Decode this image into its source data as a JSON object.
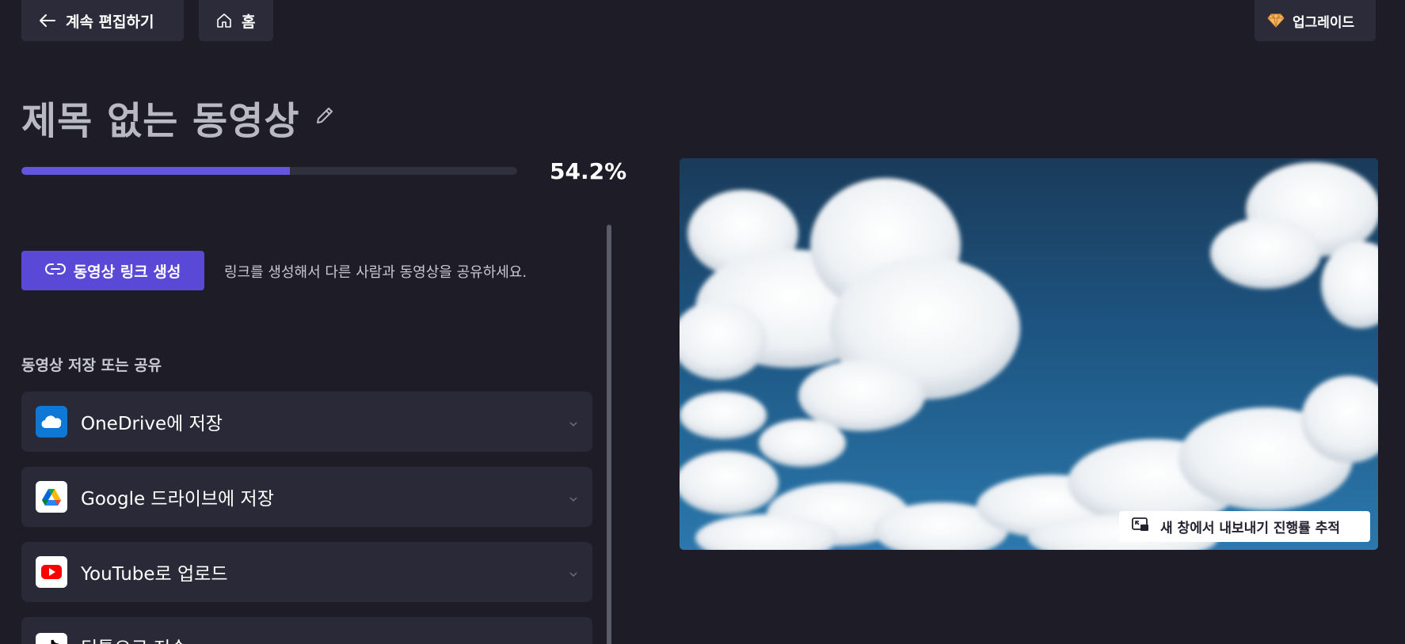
{
  "topbar": {
    "back_label": "계속 편집하기",
    "home_label": "홈",
    "upgrade_label": "업그레이드"
  },
  "title": "제목 없는 동영상",
  "progress": {
    "percent": 54.2,
    "label": "54.2%"
  },
  "share": {
    "link_button_label": "동영상 링크 생성",
    "link_description": "링크를 생성해서 다른 사람과 동영상을 공유하세요."
  },
  "save_section": {
    "heading": "동영상 저장 또는 공유",
    "items": [
      {
        "label": "OneDrive에 저장",
        "icon": "onedrive-icon"
      },
      {
        "label": "Google 드라이브에 저장",
        "icon": "google-drive-icon"
      },
      {
        "label": "YouTube로 업로드",
        "icon": "youtube-icon"
      },
      {
        "label": "틱톡으로 전송",
        "icon": "tiktok-icon"
      }
    ]
  },
  "preview": {
    "track_label": "새 창에서 내보내기 진행률 추적"
  },
  "colors": {
    "background": "#1d1c27",
    "accent": "#5a49d6",
    "progress_fill": "#6355dc",
    "card": "#292938"
  }
}
